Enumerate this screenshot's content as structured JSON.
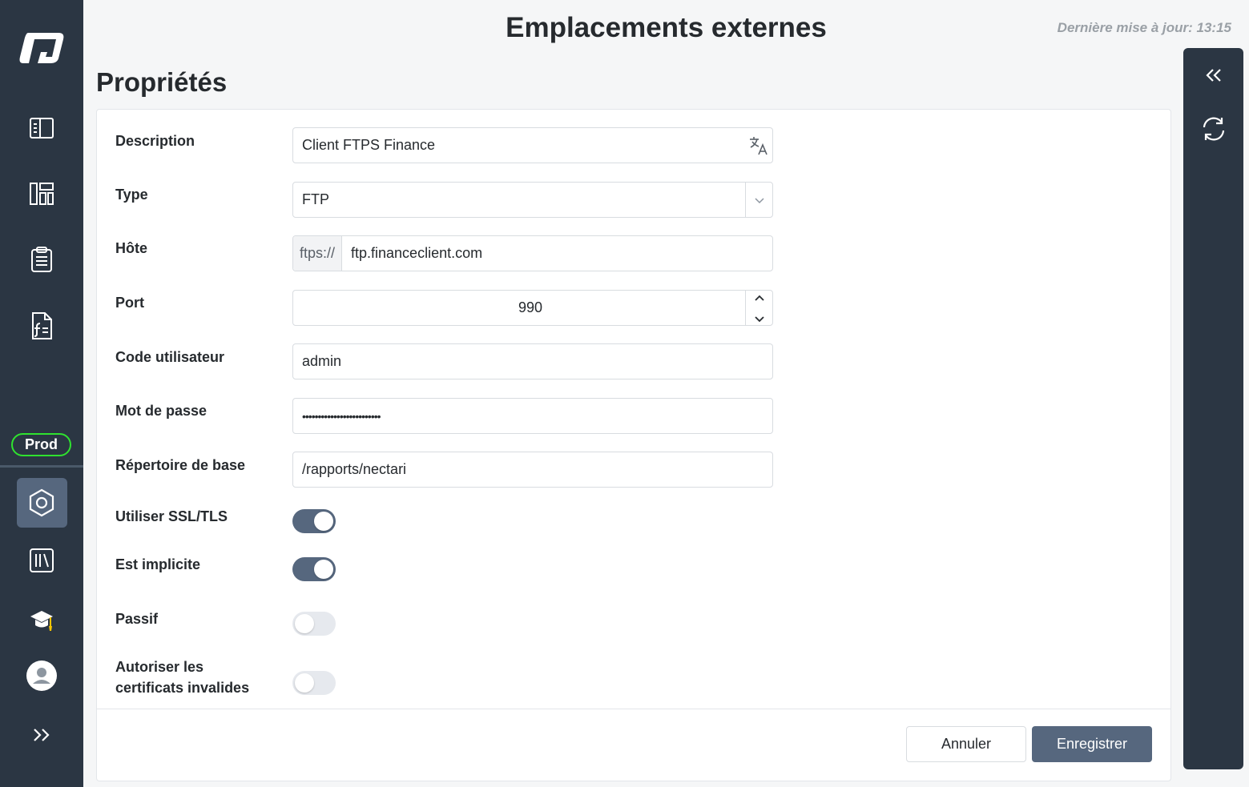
{
  "header": {
    "title": "Emplacements externes",
    "last_update": "Dernière mise à jour: 13:15"
  },
  "sidebar": {
    "environment_badge": "Prod",
    "items": [
      {
        "icon": "book-open-icon"
      },
      {
        "icon": "dashboard-icon"
      },
      {
        "icon": "clipboard-list-icon"
      },
      {
        "icon": "formula-document-icon"
      },
      {
        "icon": "hexagon-settings-icon",
        "active": true
      },
      {
        "icon": "library-icon"
      },
      {
        "icon": "graduation-cap-icon"
      },
      {
        "icon": "user-avatar-icon"
      },
      {
        "icon": "expand-chevrons-icon"
      }
    ]
  },
  "right_panel": {
    "items": [
      {
        "icon": "collapse-chevrons-icon"
      },
      {
        "icon": "refresh-icon"
      }
    ]
  },
  "section": {
    "title": "Propriétés"
  },
  "form": {
    "description": {
      "label": "Description",
      "value": "Client FTPS Finance"
    },
    "type": {
      "label": "Type",
      "value": "FTP"
    },
    "host": {
      "label": "Hôte",
      "prefix": "ftps://",
      "value": "ftp.financeclient.com"
    },
    "port": {
      "label": "Port",
      "value": "990"
    },
    "user": {
      "label": "Code utilisateur",
      "value": "admin"
    },
    "password": {
      "label": "Mot de passe",
      "value": "•••••••••••••••••••••••••"
    },
    "base_dir": {
      "label": "Répertoire de base",
      "value": "/rapports/nectari"
    },
    "use_ssl": {
      "label": "Utiliser SSL/TLS",
      "checked": true
    },
    "implicit": {
      "label": "Est implicite",
      "checked": true
    },
    "passive": {
      "label": "Passif",
      "checked": false
    },
    "allow_invalid": {
      "label_line1": "Autoriser les",
      "label_line2": "certificats invalides",
      "checked": false
    }
  },
  "actions": {
    "cancel_label": "Annuler",
    "save_label": "Enregistrer"
  },
  "colors": {
    "sidebar_bg": "#2b3643",
    "accent": "#56677e",
    "env_badge_border": "#2fe22f",
    "page_bg": "#f5f6f7"
  }
}
